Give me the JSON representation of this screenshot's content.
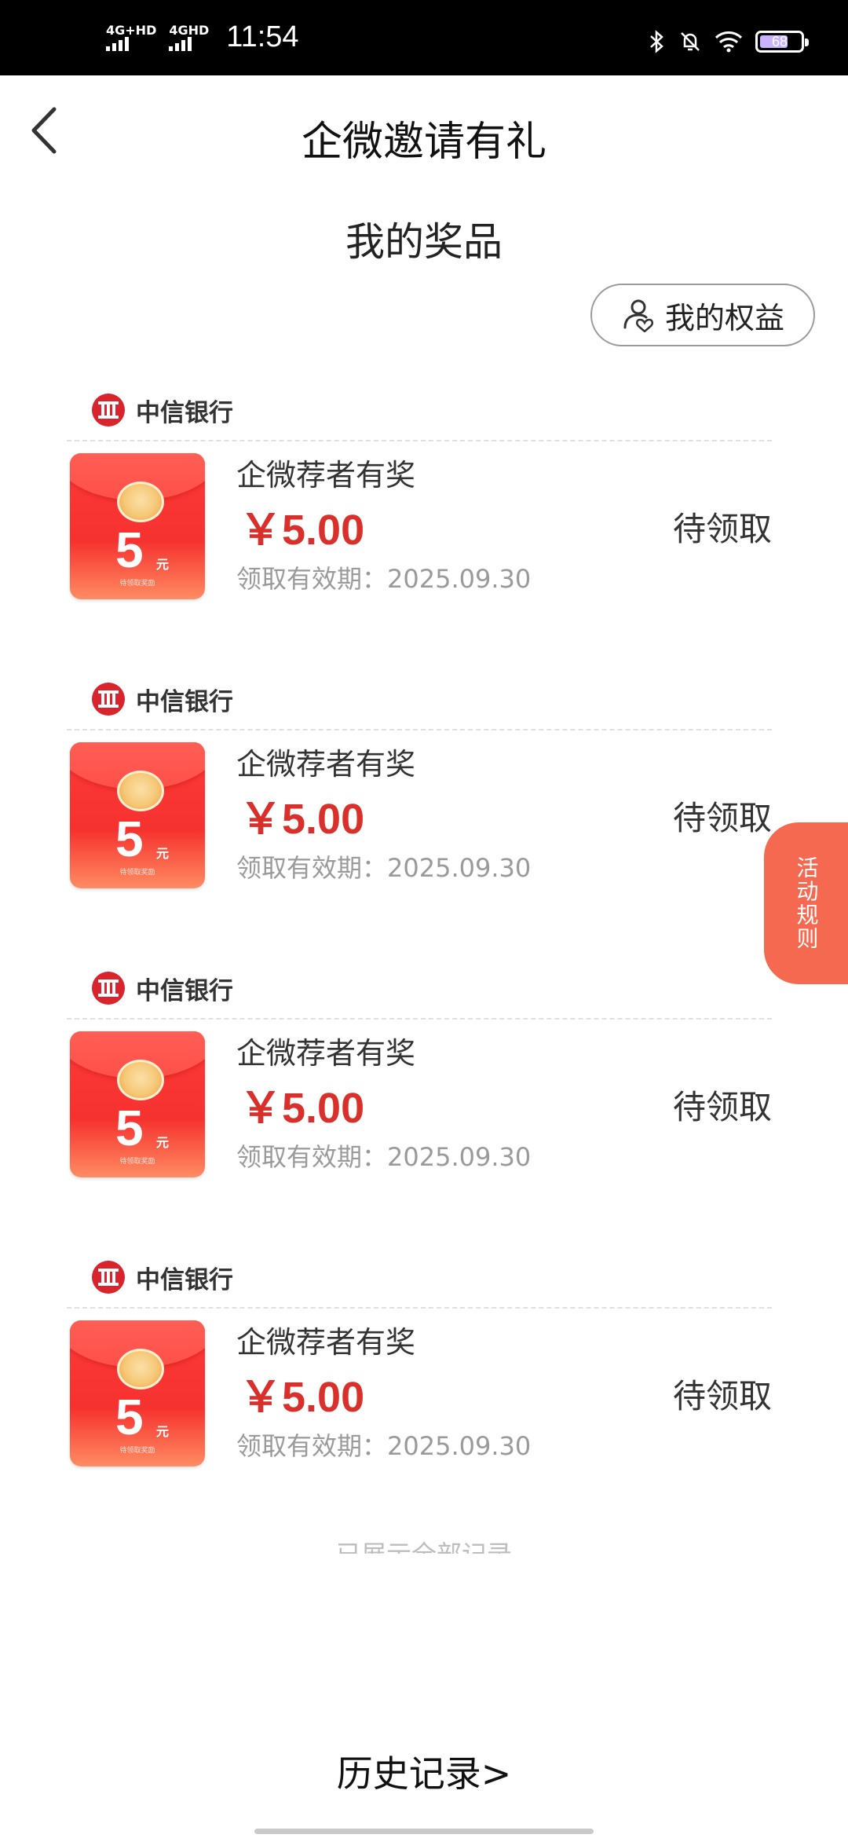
{
  "status_bar": {
    "network1": "4G+HD",
    "network2": "4GHD",
    "time": "11:54",
    "battery": "68"
  },
  "header": {
    "title": "企微邀请有礼"
  },
  "section_title": "我的奖品",
  "benefits_button": "我的权益",
  "prizes": [
    {
      "bank": "中信银行",
      "envelope_amount": "5",
      "envelope_unit": "元",
      "envelope_note": "待领取奖励",
      "name": "企微荐者有奖",
      "amount": "￥5.00",
      "expiry": "领取有效期：2025.09.30",
      "status": "待领取"
    },
    {
      "bank": "中信银行",
      "envelope_amount": "5",
      "envelope_unit": "元",
      "envelope_note": "待领取奖励",
      "name": "企微荐者有奖",
      "amount": "￥5.00",
      "expiry": "领取有效期：2025.09.30",
      "status": "待领取"
    },
    {
      "bank": "中信银行",
      "envelope_amount": "5",
      "envelope_unit": "元",
      "envelope_note": "待领取奖励",
      "name": "企微荐者有奖",
      "amount": "￥5.00",
      "expiry": "领取有效期：2025.09.30",
      "status": "待领取"
    },
    {
      "bank": "中信银行",
      "envelope_amount": "5",
      "envelope_unit": "元",
      "envelope_note": "待领取奖励",
      "name": "企微荐者有奖",
      "amount": "￥5.00",
      "expiry": "领取有效期：2025.09.30",
      "status": "待领取"
    }
  ],
  "list_end": "已展示全部记录",
  "rules_tab": "活动规则",
  "history_link": "历史记录>",
  "colors": {
    "accent_red": "#d9302c",
    "rules_tab": "#f4694f"
  }
}
